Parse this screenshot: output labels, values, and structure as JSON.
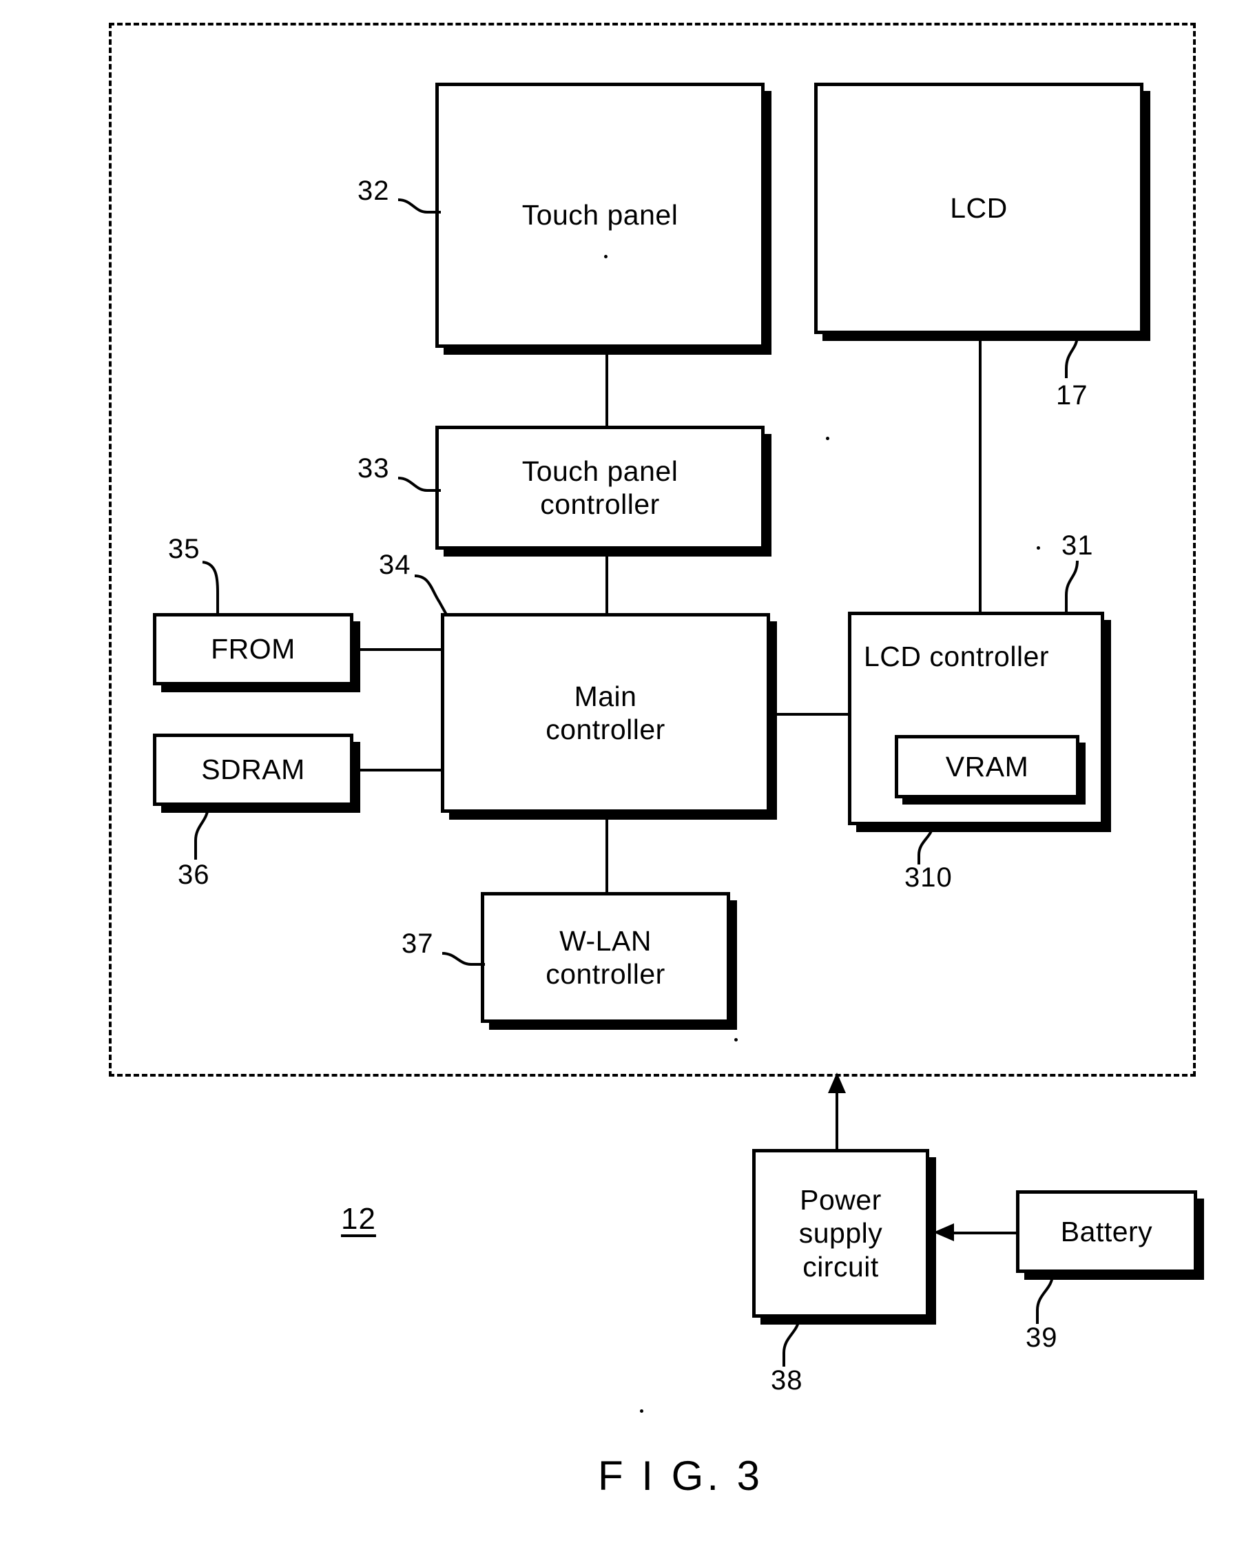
{
  "figure": {
    "caption": "F I G. 3",
    "enclosure_ref": "12"
  },
  "blocks": {
    "touch_panel": {
      "label": "Touch panel",
      "ref": "32"
    },
    "lcd": {
      "label": "LCD",
      "ref": "17"
    },
    "touch_panel_controller": {
      "label": "Touch panel\ncontroller",
      "ref": "33"
    },
    "from": {
      "label": "FROM",
      "ref": "35"
    },
    "sdram": {
      "label": "SDRAM",
      "ref": "36"
    },
    "main_controller": {
      "label": "Main\ncontroller",
      "ref": "34"
    },
    "lcd_controller": {
      "label": "LCD controller",
      "ref": "31"
    },
    "vram": {
      "label": "VRAM",
      "ref": "310"
    },
    "wlan_controller": {
      "label": "W-LAN\ncontroller",
      "ref": "37"
    },
    "power_supply_circuit": {
      "label": "Power\nsupply\ncircuit",
      "ref": "38"
    },
    "battery": {
      "label": "Battery",
      "ref": "39"
    }
  },
  "colors": {
    "ink": "#000000",
    "paper": "#ffffff"
  }
}
